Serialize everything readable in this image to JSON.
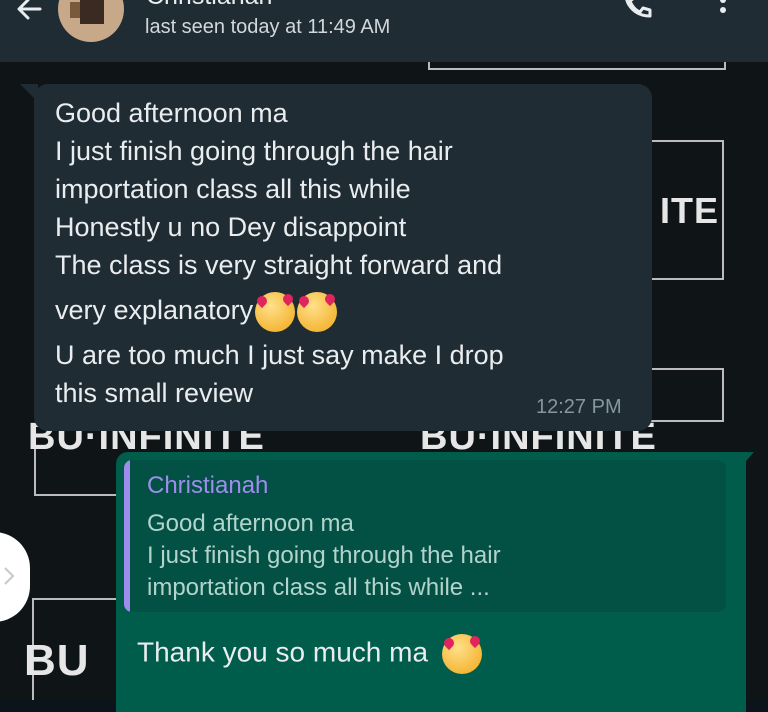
{
  "header": {
    "contact_name": "Christianah",
    "last_seen": "last seen today at 11:49 AM"
  },
  "wallpaper": {
    "watermark_texts": [
      "ITE",
      "BU·INFINITE",
      "BU·INFINITE",
      "BU"
    ]
  },
  "incoming": {
    "lines": [
      "Good afternoon ma",
      "I just finish going through the hair",
      "importation class all this while",
      "Honestly u no Dey disappoint",
      "The class is very straight forward and",
      "very explanatory",
      "U are too much I just say make I drop",
      "this small review"
    ],
    "time": "12:27 PM"
  },
  "outgoing": {
    "quote_author": "Christianah",
    "quote_lines": [
      "Good afternoon ma",
      "I just finish going through the hair",
      "importation class all this while ..."
    ],
    "reply_lines": [
      "Thank you so much ma"
    ]
  },
  "colors": {
    "header": "#1f2c34",
    "incoming_bubble": "#202c33",
    "outgoing_bubble": "#005c4b",
    "quote_accent": "#9f8dee"
  },
  "icons": [
    "back-arrow-icon",
    "call-icon",
    "more-vert-icon",
    "emoji-smiling-hearts-icon",
    "chevron-right-icon"
  ]
}
